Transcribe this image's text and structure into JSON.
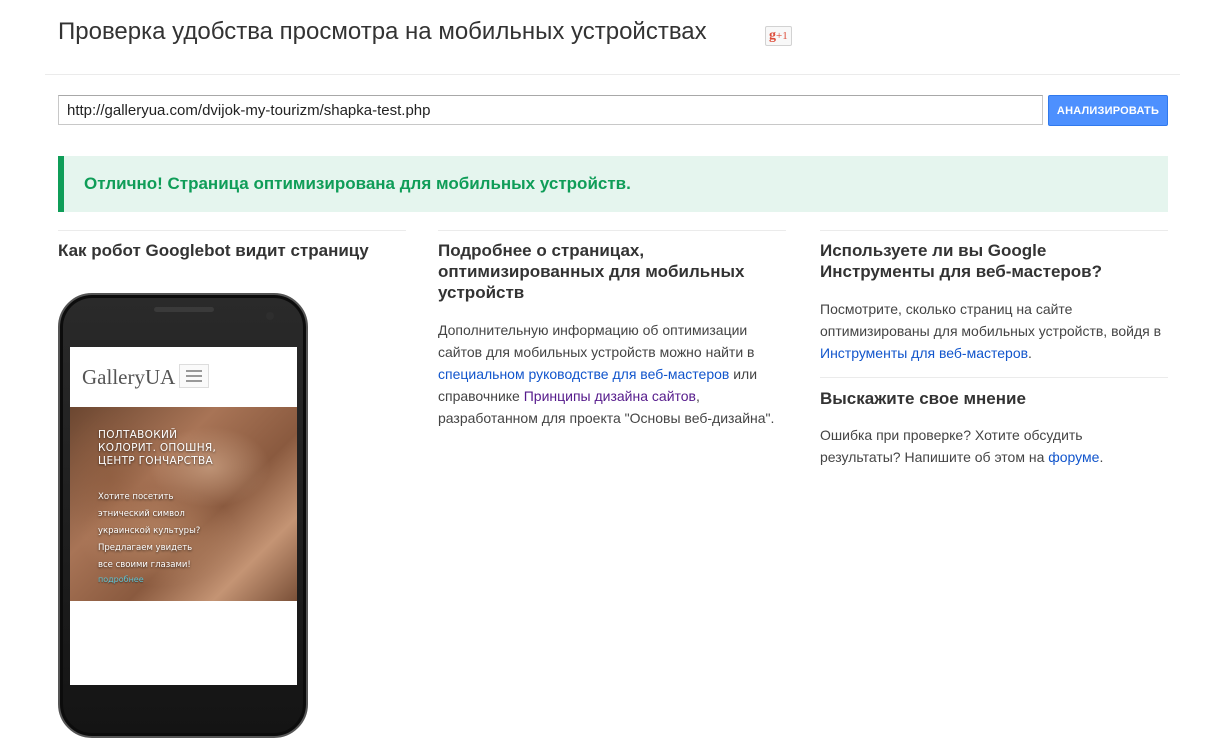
{
  "header": {
    "title": "Проверка удобства просмотра на мобильных устройствах",
    "gplus_label": "g",
    "gplus_suffix": "+1"
  },
  "form": {
    "url_value": "http://galleryua.com/dvijok-my-tourizm/shapka-test.php",
    "analyze_label": "АНАЛИЗИРОВАТЬ"
  },
  "result": {
    "message": "Отлично! Страница оптимизирована для мобильных устройств."
  },
  "left": {
    "heading": "Как робот Googlebot видит страницу",
    "preview": {
      "logo": "GalleryUA",
      "hero_title_lines": [
        "ПОЛТАВОКИЙ",
        "КОЛОРИТ. ОПОШНЯ,",
        "ЦЕНТР ГОНЧАРСТВА"
      ],
      "hero_text_lines": [
        "Хотите посетить",
        "этнический символ",
        "украинской культуры?",
        "Предлагаем увидеть",
        "все своими глазами!"
      ],
      "more_link": "подробнее"
    }
  },
  "middle": {
    "heading": "Подробнее о страницах, оптимизированных для мобильных устройств",
    "text_1": "Дополнительную информацию об оптимизации сайтов для мобильных устройств можно найти в ",
    "link_1": "специальном руководстве для веб-мастеров",
    "text_2": " или справочнике ",
    "link_2": "Принципы дизайна сайтов",
    "text_3": ", разработанном для проекта \"Основы веб-дизайна\"."
  },
  "right": {
    "heading_1": "Используете ли вы Google Инструменты для веб-мастеров?",
    "text_1": "Посмотрите, сколько страниц на сайте оптимизированы для мобильных устройств, войдя в ",
    "link_1": "Инструменты для веб-мастеров",
    "text_1_end": ".",
    "heading_2": "Выскажите свое мнение",
    "text_2": "Ошибка при проверке? Хотите обсудить результаты? Напишите об этом на ",
    "link_2": "форуме",
    "text_2_end": "."
  },
  "colors": {
    "accent_blue": "#4d90fe",
    "success_green": "#0f9d58",
    "success_bg": "#e5f5ee",
    "link": "#1155cc",
    "link_visited": "#551a8b"
  }
}
